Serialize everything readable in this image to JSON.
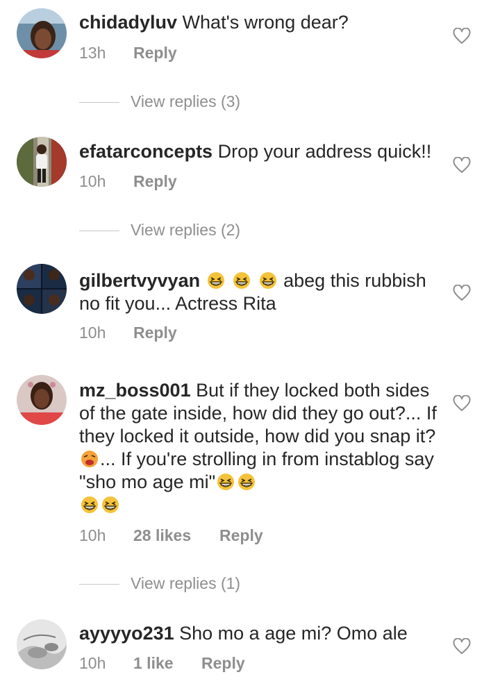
{
  "comments": [
    {
      "username": "chidadyluv",
      "text": " What's wrong dear?",
      "time": "13h",
      "likes": "",
      "reply_label": "Reply",
      "view_replies": "View replies (3)"
    },
    {
      "username": "efatarconcepts",
      "text": " Drop your address quick!!",
      "time": "10h",
      "likes": "",
      "reply_label": "Reply",
      "view_replies": "View replies (2)"
    },
    {
      "username": "gilbertvyvyan",
      "text_after_emoji": " abeg this rubbish no fit you... Actress Rita",
      "time": "10h",
      "likes": "",
      "reply_label": "Reply",
      "view_replies": ""
    },
    {
      "username": "mz_boss001",
      "text_part1": " But if they locked both sides of the gate inside, how did they go out?... If they locked it outside, how did you snap it?",
      "text_part2": "... If you're strolling in from instablog say \"sho mo age mi\"",
      "time": "10h",
      "likes": "28 likes",
      "reply_label": "Reply",
      "view_replies": "View replies (1)"
    },
    {
      "username": "ayyyyo231",
      "text": " Sho mo a age mi?  Omo ale",
      "time": "10h",
      "likes": "1 like",
      "reply_label": "Reply",
      "view_replies": ""
    }
  ],
  "colors": {
    "text": "#262626",
    "secondary": "#8e8e8e",
    "emoji_face": "#f5c33b"
  },
  "icons": {
    "like": "heart-outline-icon",
    "laughing": "grinning-squinting-face-emoji",
    "tired": "tired-face-emoji"
  }
}
